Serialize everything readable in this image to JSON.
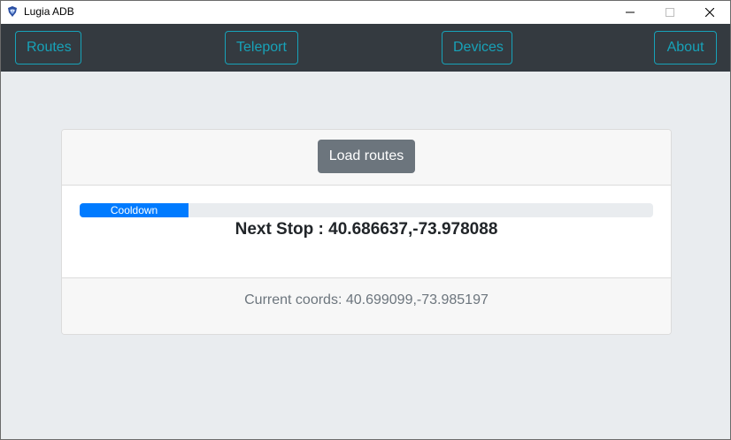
{
  "window": {
    "title": "Lugia ADB"
  },
  "icons": {
    "app": "lugia-app-icon",
    "minimize": "minimize-icon",
    "maximize": "maximize-icon",
    "close": "close-icon"
  },
  "navbar": {
    "items": [
      {
        "label": "Routes"
      },
      {
        "label": "Teleport"
      },
      {
        "label": "Devices"
      },
      {
        "label": "About"
      }
    ]
  },
  "card": {
    "load_button_label": "Load routes",
    "progress": {
      "label": "Cooldown",
      "value_percent": 19
    },
    "next_stop_text": "Next Stop : 40.686637,-73.978088",
    "current_coords_text": "Current coords: 40.699099,-73.985197"
  },
  "colors": {
    "navbar_bg": "#343a40",
    "nav_accent": "#17a2b8",
    "progress_fill": "#007bff",
    "load_button_bg": "#6c757d",
    "page_bg": "#e9ecef"
  }
}
